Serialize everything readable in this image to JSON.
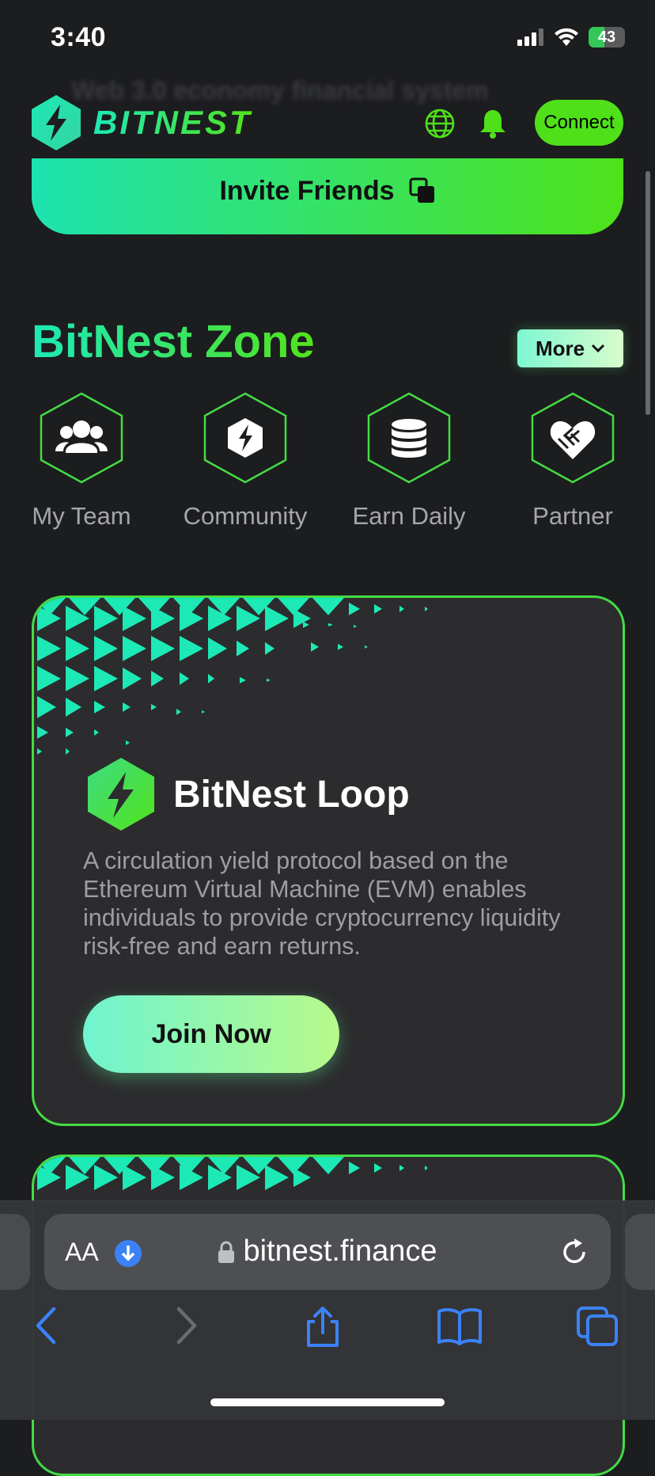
{
  "status_bar": {
    "time": "3:40",
    "battery": "43",
    "icons": [
      "signal-icon",
      "wifi-icon",
      "battery-charging-icon"
    ]
  },
  "header": {
    "brand": "BITNEST",
    "ghost_text": "Web 3.0 economy financial system",
    "connect_label": "Connect",
    "icons": [
      "globe-icon",
      "bell-icon"
    ]
  },
  "invite": {
    "label": "Invite Friends",
    "icon": "copy-icon"
  },
  "zone": {
    "title": "BitNest Zone",
    "more_label": "More",
    "items": [
      {
        "label": "My Team",
        "icon": "users-icon"
      },
      {
        "label": "Community",
        "icon": "bolt-hex-icon"
      },
      {
        "label": "Earn Daily",
        "icon": "coins-stack-icon"
      },
      {
        "label": "Partner",
        "icon": "handshake-heart-icon"
      }
    ]
  },
  "loop_card": {
    "title": "BitNest Loop",
    "description": "A circulation yield protocol based on the Ethereum Virtual Machine (EVM) enables individuals to provide cryptocurrency liquidity risk-free and earn returns.",
    "button_label": "Join Now"
  },
  "browser": {
    "aa_label": "AA",
    "url": "bitnest.finance",
    "nav_icons": [
      "back-icon",
      "forward-icon",
      "share-icon",
      "bookmarks-icon",
      "tabs-icon"
    ]
  },
  "colors": {
    "accent_green": "#4fe01a",
    "accent_teal": "#1de9b6",
    "background": "#1c1d1f",
    "card": "#2c2c2e"
  }
}
